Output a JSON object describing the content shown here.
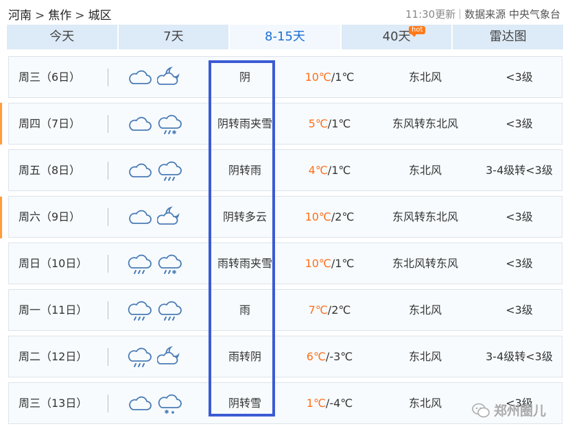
{
  "breadcrumb": [
    "河南",
    "焦作",
    "城区"
  ],
  "breadcrumb_sep": ">",
  "update_time": "11:30更新",
  "data_source": "数据来源 中央气象台",
  "tabs": [
    {
      "label": "今天"
    },
    {
      "label": "7天"
    },
    {
      "label": "8-15天"
    },
    {
      "label": "40天",
      "badge": "hot"
    },
    {
      "label": "雷达图"
    }
  ],
  "active_tab": "8-15天",
  "colors": {
    "accent": "#1b6ed3",
    "high_temp": "#ff6e1a",
    "highlight_box": "#3b5bd4",
    "tab_bg": "#ddeaf7"
  },
  "forecast": [
    {
      "day": "周三（6日）",
      "icons": [
        "cloudy-icon",
        "partly-cloudy-night-icon"
      ],
      "desc": "阴",
      "high": "10℃",
      "low": "/1℃",
      "wind": "东北风",
      "level": "<3级"
    },
    {
      "day": "周四（7日）",
      "icons": [
        "cloudy-icon",
        "sleet-icon"
      ],
      "desc": "阴转雨夹雪",
      "high": "5℃",
      "low": "/1℃",
      "wind": "东风转东北风",
      "level": "<3级"
    },
    {
      "day": "周五（8日）",
      "icons": [
        "cloudy-icon",
        "rain-icon"
      ],
      "desc": "阴转雨",
      "high": "4℃",
      "low": "/1℃",
      "wind": "东北风",
      "level": "3-4级转<3级"
    },
    {
      "day": "周六（9日）",
      "icons": [
        "cloudy-icon",
        "partly-cloudy-night-icon"
      ],
      "desc": "阴转多云",
      "high": "10℃",
      "low": "/2℃",
      "wind": "东风转东北风",
      "level": "<3级"
    },
    {
      "day": "周日（10日）",
      "icons": [
        "rain-icon",
        "sleet-icon"
      ],
      "desc": "雨转雨夹雪",
      "high": "10℃",
      "low": "/1℃",
      "wind": "东北风转东风",
      "level": "<3级"
    },
    {
      "day": "周一（11日）",
      "icons": [
        "rain-icon",
        "rain-icon"
      ],
      "desc": "雨",
      "high": "7℃",
      "low": "/2℃",
      "wind": "东北风",
      "level": "<3级"
    },
    {
      "day": "周二（12日）",
      "icons": [
        "rain-icon",
        "partly-cloudy-night-icon"
      ],
      "desc": "雨转阴",
      "high": "6℃",
      "low": "/-3℃",
      "wind": "东北风",
      "level": "3-4级转<3级"
    },
    {
      "day": "周三（13日）",
      "icons": [
        "cloudy-icon",
        "snow-icon"
      ],
      "desc": "阴转雪",
      "high": "1℃",
      "low": "/-4℃",
      "wind": "东北风",
      "level": "<3级"
    }
  ],
  "watermark": "郑州圈儿"
}
